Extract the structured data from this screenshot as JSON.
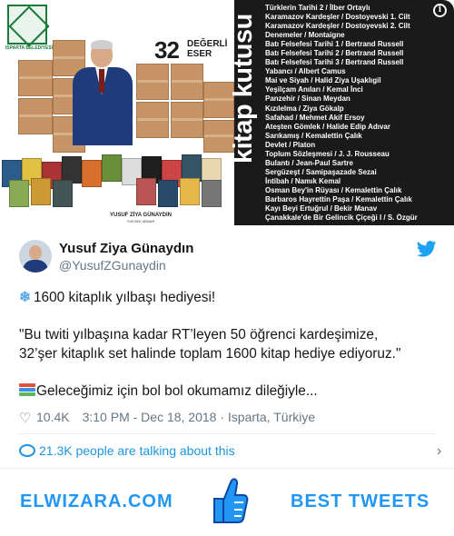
{
  "promo": {
    "logo_caption": "ISPARTA BELEDİYESİ",
    "badge_number": "32",
    "badge_word_1": "DEĞERLİ",
    "badge_word_2": "ESER",
    "vertical_title": "kitap kutusu",
    "person_name": "YUSUF ZİYA GÜNAYDIN",
    "person_caption": "YÜKSEK MİMAR",
    "book_list": [
      "Türklerin Tarihi 2 / İlber Ortaylı",
      "Karamazov Kardeşler / Dostoyevski 1. Cilt",
      "Karamazov Kardeşler / Dostoyevski 2. Cilt",
      "Denemeler / Montaigne",
      "Batı Felsefesi Tarihi 1 / Bertrand Russell",
      "Batı Felsefesi Tarihi 2 / Bertrand Russell",
      "Batı Felsefesi Tarihi 3 / Bertrand Russell",
      "Yabancı / Albert Camus",
      "Mai ve Siyah / Halid Ziya Uşaklıgil",
      "Yeşilçam Anıları / Kemal İnci",
      "Panzehir / Sinan Meydan",
      "Kızılelma / Ziya Gökalp",
      "Safahad / Mehmet Akif Ersoy",
      "Ateşten Gömlek / Halide Edip Adıvar",
      "Sarıkamış / Kemalettin Çalık",
      "Devlet / Platon",
      "Toplum Sözleşmesi / J. J. Rousseau",
      "Bulantı / Jean-Paul Sartre",
      "Sergüzeşt / Samipaşazade Sezai",
      "İntibah / Namık Kemal",
      "Osman Bey'in Rüyası / Kemalettin Çalık",
      "Barbaros Hayrettin Paşa / Kemalettin Çalık",
      "Kayı Beyi Ertuğrul / Bekir Manav",
      "Çanakkale'de Bir Gelincik Çiçeği I / S. Özgür"
    ],
    "info_icon": "info-icon"
  },
  "tweet": {
    "display_name": "Yusuf Ziya Günaydın",
    "handle": "@YusufZGunaydin",
    "lines": [
      "1600 kitaplık yılbaşı hediyesi!",
      "",
      "\"Bu twiti yılbaşına kadar RT’leyen 50 öğrenci kardeşimize,",
      "32’şer kitaplık set halinde toplam 1600 kitap hediye ediyoruz.\"",
      "",
      "Geleceğimiz için bol bol okumamız dileğiyle..."
    ],
    "likes": "10.4K",
    "timestamp": "3:10 PM - Dec 18, 2018",
    "separator": "·",
    "location": "Isparta, Türkiye",
    "talking": "21.3K people are talking about this",
    "link_color": "#1b95e0"
  },
  "footer": {
    "brand_left": "ELWIZARA.COM",
    "brand_right": "BEST TWEETS",
    "brand_color": "#2196f3"
  }
}
